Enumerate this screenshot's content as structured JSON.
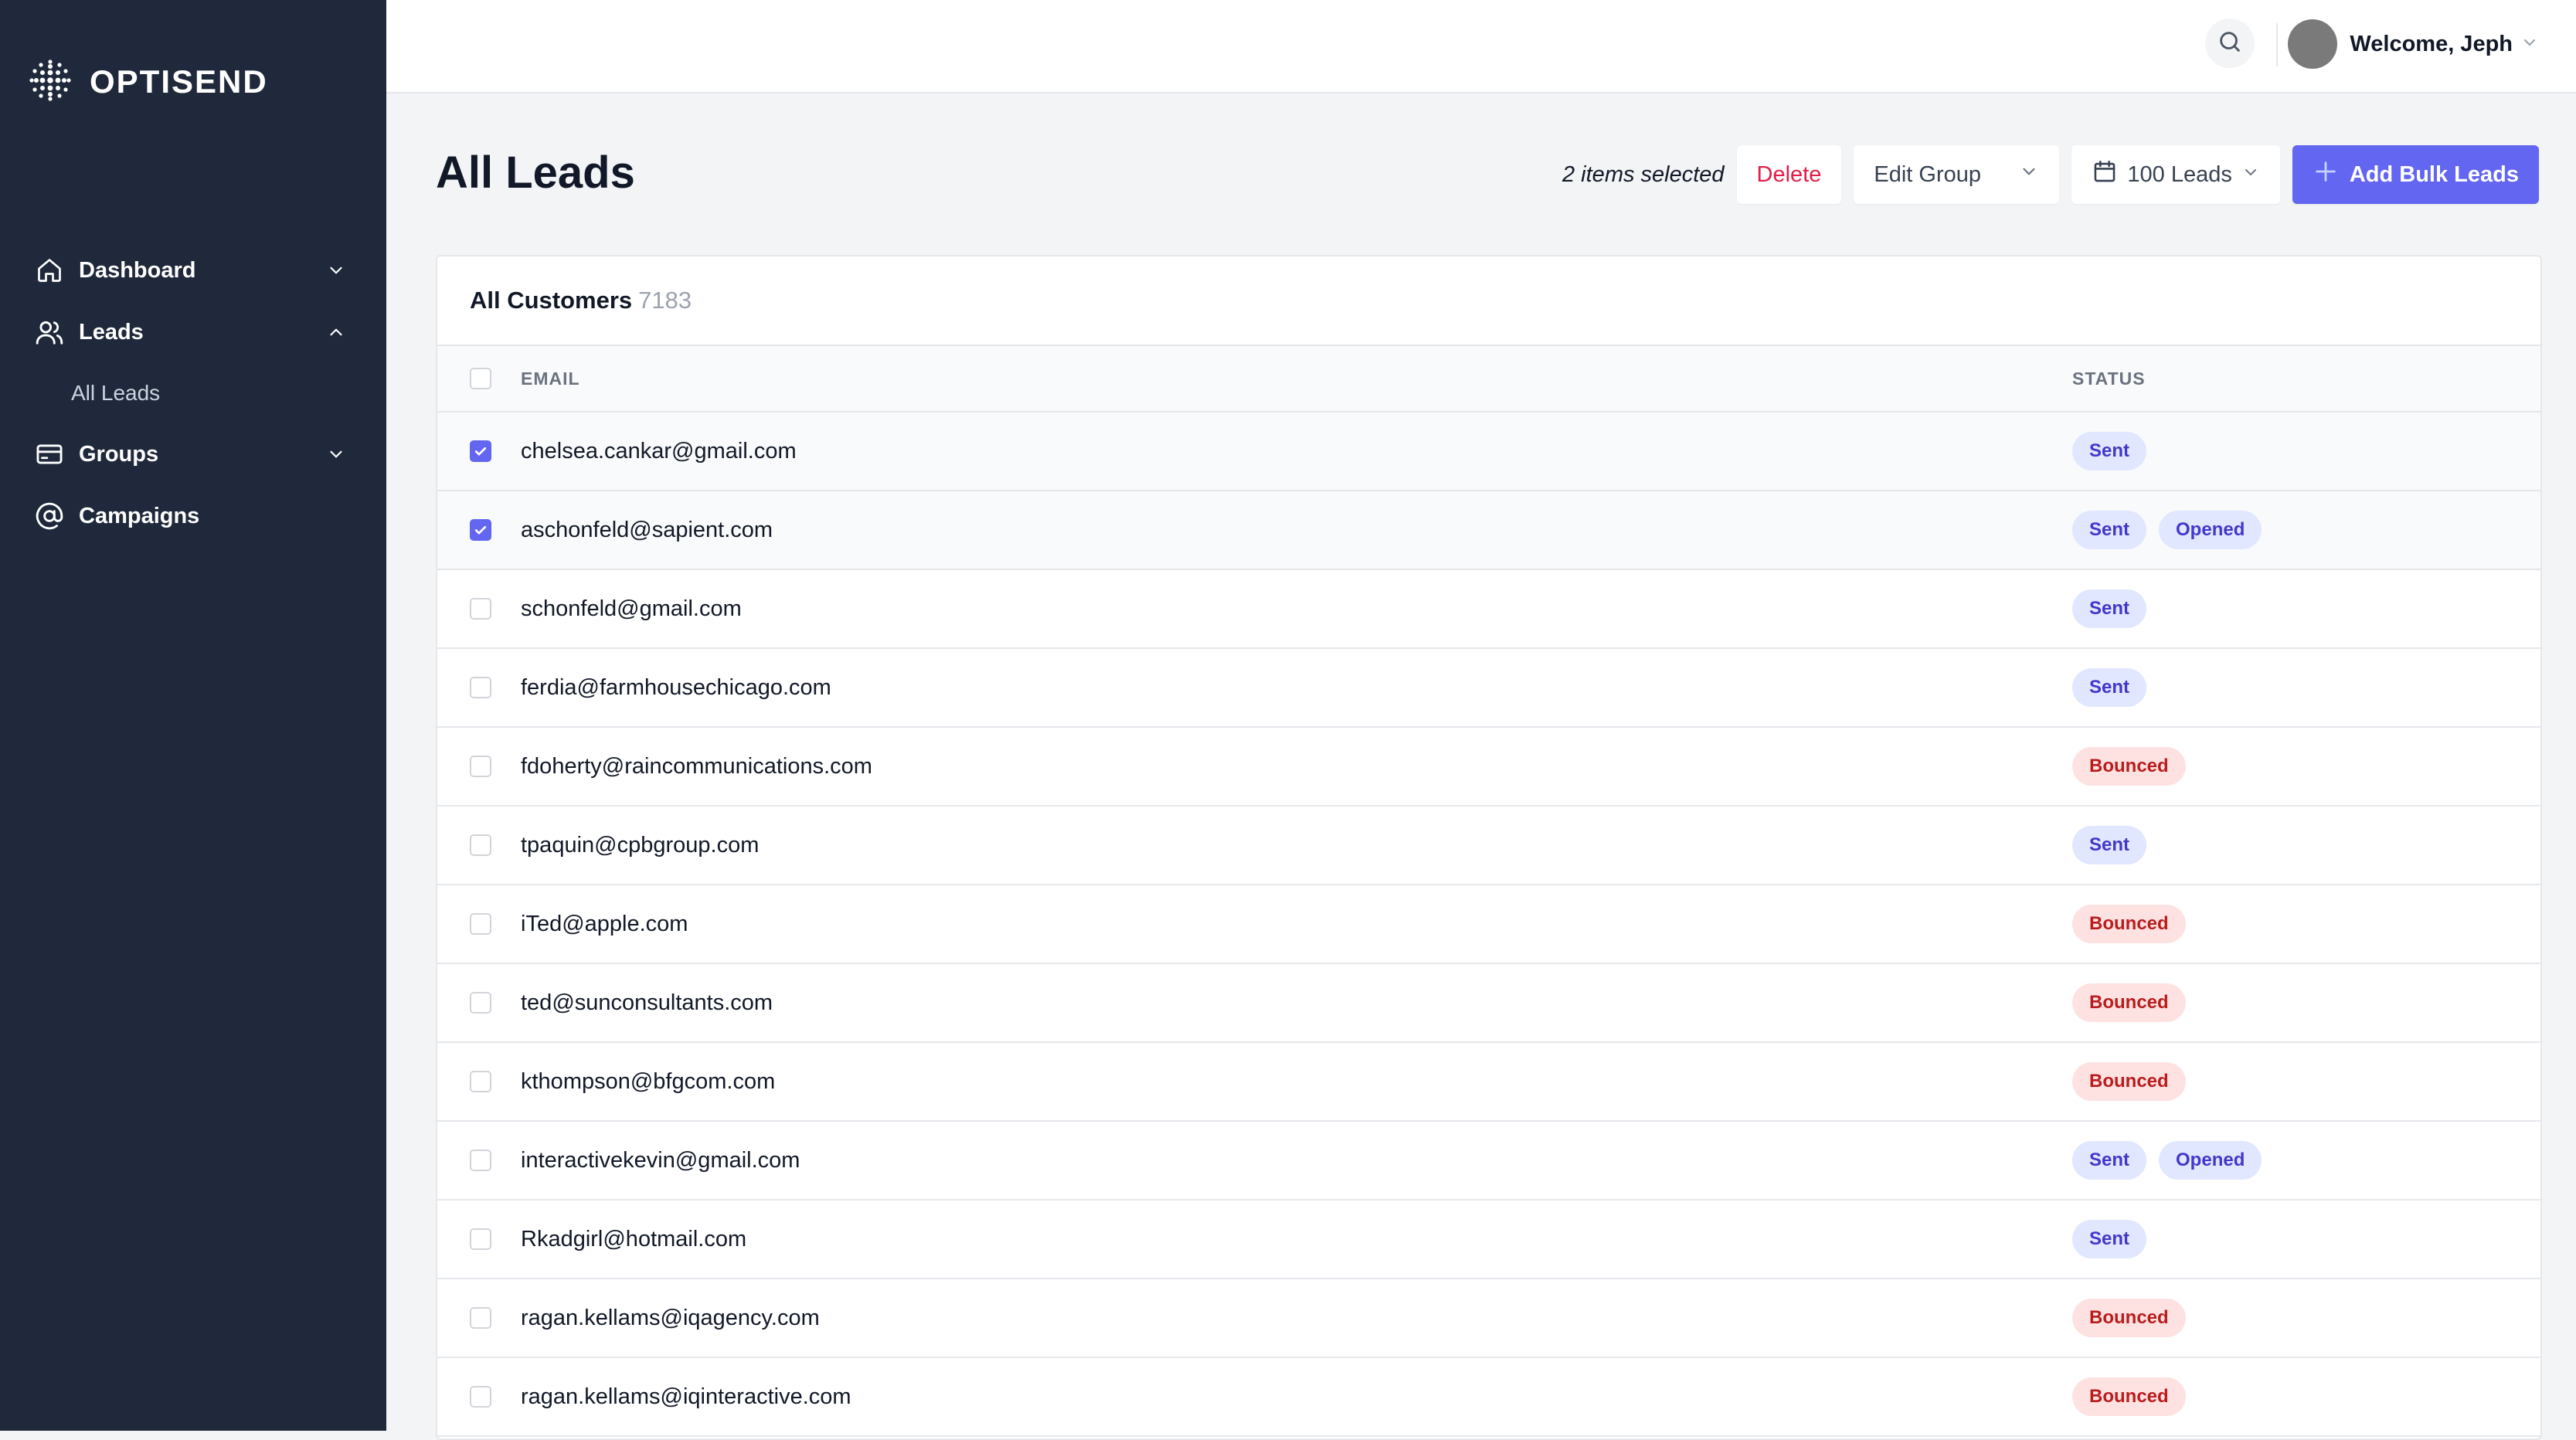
{
  "brand": {
    "name": "OPTISEND"
  },
  "sidebar": {
    "items": [
      {
        "label": "Dashboard",
        "icon": "home-icon",
        "chevron": "down"
      },
      {
        "label": "Leads",
        "icon": "users-icon",
        "chevron": "up"
      },
      {
        "label": "All Leads",
        "sub": true
      },
      {
        "label": "Groups",
        "icon": "card-icon",
        "chevron": "down"
      },
      {
        "label": "Campaigns",
        "icon": "at-icon"
      }
    ]
  },
  "topbar": {
    "welcome": "Welcome, Jeph"
  },
  "header": {
    "title": "All Leads",
    "selected_text": "2 items selected",
    "delete_label": "Delete",
    "edit_group_label": "Edit Group",
    "leads_count_label": "100 Leads",
    "add_bulk_label": "Add Bulk Leads"
  },
  "table": {
    "title": "All Customers",
    "count": "7183",
    "columns": [
      "EMAIL",
      "STATUS"
    ],
    "rows": [
      {
        "email": "chelsea.cankar@gmail.com",
        "checked": true,
        "status": [
          "Sent"
        ]
      },
      {
        "email": "aschonfeld@sapient.com",
        "checked": true,
        "status": [
          "Sent",
          "Opened"
        ]
      },
      {
        "email": "schonfeld@gmail.com",
        "checked": false,
        "status": [
          "Sent"
        ]
      },
      {
        "email": "ferdia@farmhousechicago.com",
        "checked": false,
        "status": [
          "Sent"
        ]
      },
      {
        "email": "fdoherty@raincommunications.com",
        "checked": false,
        "status": [
          "Bounced"
        ]
      },
      {
        "email": "tpaquin@cpbgroup.com",
        "checked": false,
        "status": [
          "Sent"
        ]
      },
      {
        "email": "iTed@apple.com",
        "checked": false,
        "status": [
          "Bounced"
        ]
      },
      {
        "email": "ted@sunconsultants.com",
        "checked": false,
        "status": [
          "Bounced"
        ]
      },
      {
        "email": "kthompson@bfgcom.com",
        "checked": false,
        "status": [
          "Bounced"
        ]
      },
      {
        "email": "interactivekevin@gmail.com",
        "checked": false,
        "status": [
          "Sent",
          "Opened"
        ]
      },
      {
        "email": "Rkadgirl@hotmail.com",
        "checked": false,
        "status": [
          "Sent"
        ]
      },
      {
        "email": "ragan.kellams@iqagency.com",
        "checked": false,
        "status": [
          "Bounced"
        ]
      },
      {
        "email": "ragan.kellams@iqinteractive.com",
        "checked": false,
        "status": [
          "Bounced"
        ]
      }
    ]
  },
  "colors": {
    "sidebar_bg": "#1F293B",
    "accent": "#6366F1",
    "danger": "#E11D48",
    "sent_badge_bg": "#E0E7FF",
    "bounced_badge_bg": "#FEE2E2"
  }
}
